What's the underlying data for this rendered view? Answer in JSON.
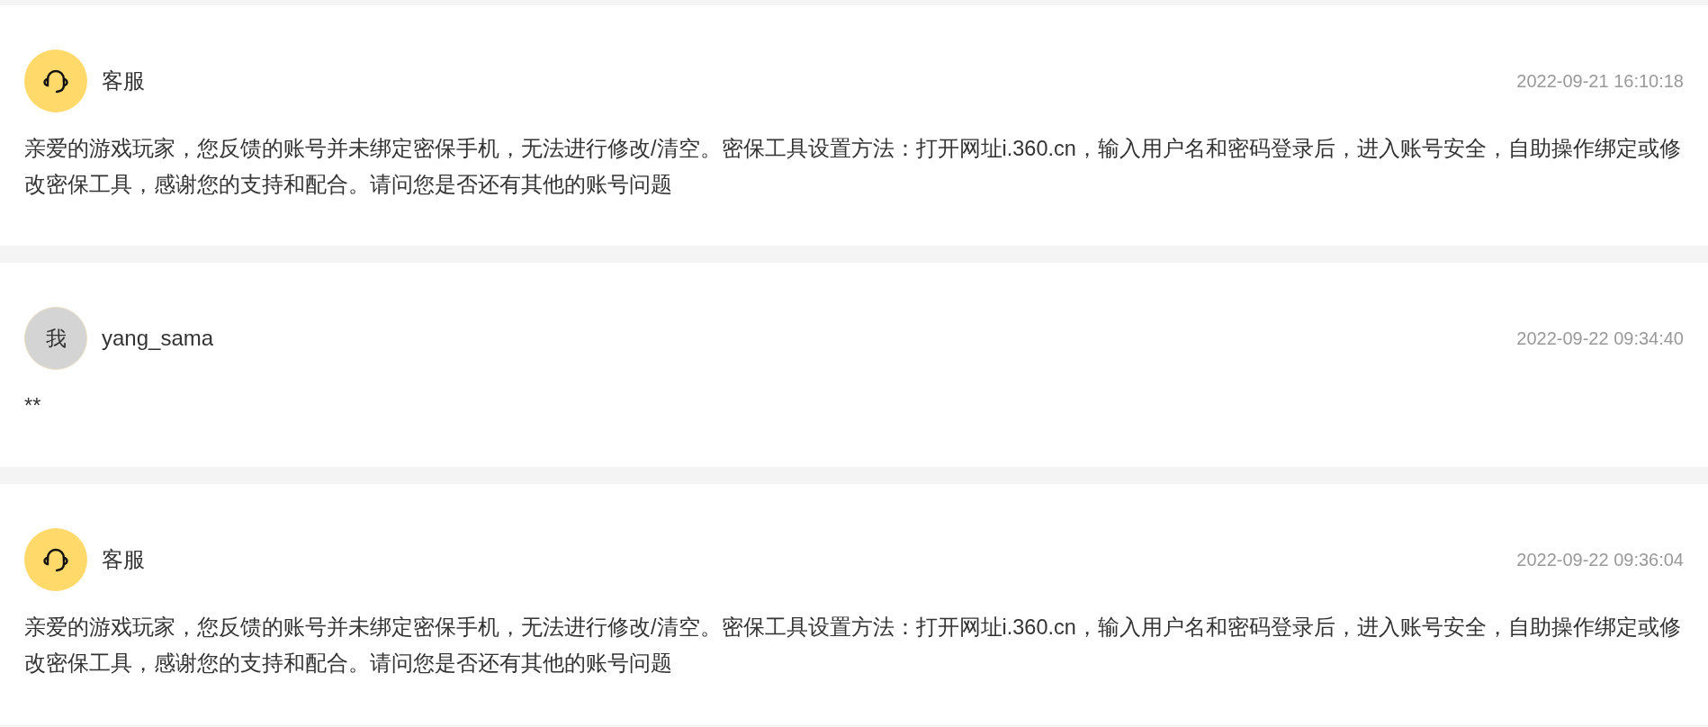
{
  "messages": [
    {
      "kind": "service",
      "sender": "客服",
      "time": "2022-09-21 16:10:18",
      "text": "亲爱的游戏玩家，您反馈的账号并未绑定密保手机，无法进行修改/清空。密保工具设置方法：打开网址i.360.cn，输入用户名和密码登录后，进入账号安全，自助操作绑定或修改密保工具，感谢您的支持和配合。请问您是否还有其他的账号问题"
    },
    {
      "kind": "user",
      "avatar_text": "我",
      "sender": "yang_sama",
      "time": "2022-09-22 09:34:40",
      "text": "**"
    },
    {
      "kind": "service",
      "sender": "客服",
      "time": "2022-09-22 09:36:04",
      "text": "亲爱的游戏玩家，您反馈的账号并未绑定密保手机，无法进行修改/清空。密保工具设置方法：打开网址i.360.cn，输入用户名和密码登录后，进入账号安全，自助操作绑定或修改密保工具，感谢您的支持和配合。请问您是否还有其他的账号问题"
    }
  ]
}
